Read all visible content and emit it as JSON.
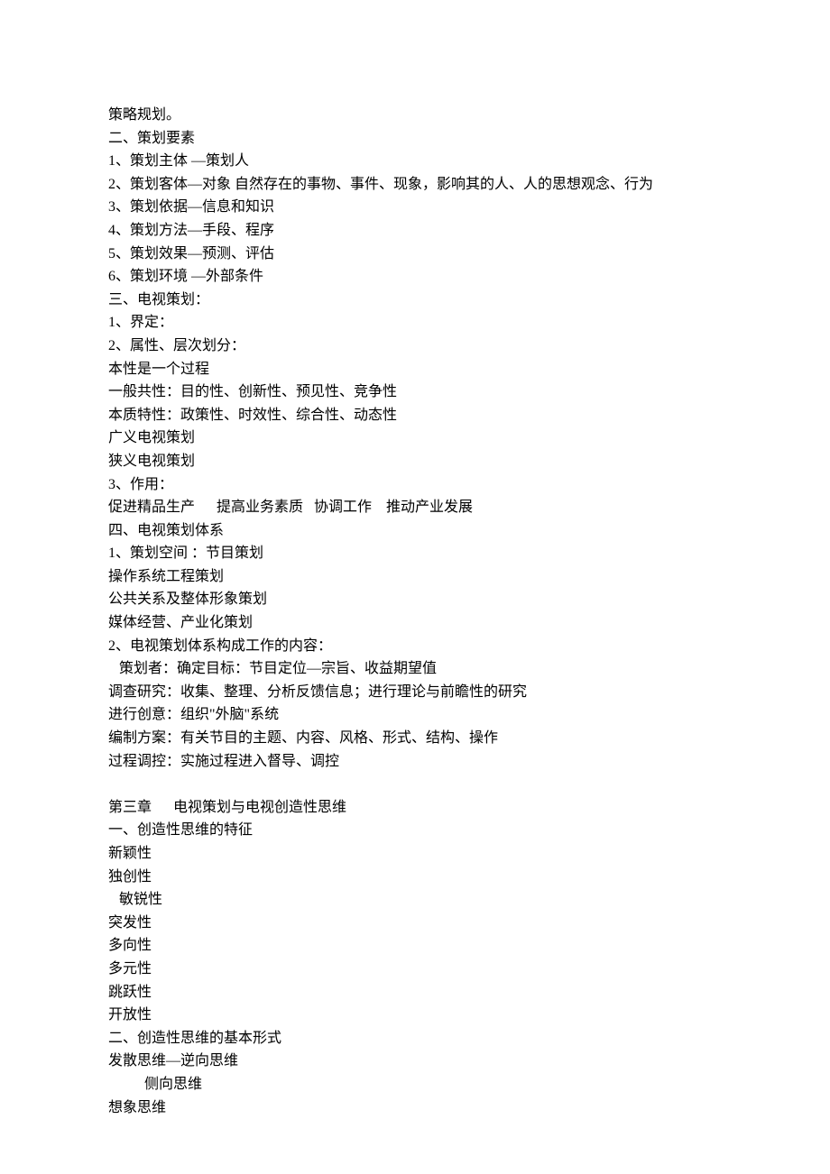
{
  "lines": [
    "策略规划。",
    "二、策划要素",
    "1、策划主体 —策划人",
    "2、策划客体—对象 自然存在的事物、事件、现象，影响其的人、人的思想观念、行为",
    "3、策划依据—信息和知识",
    "4、策划方法—手段、程序",
    "5、策划效果—预测、评估",
    "6、策划环境 —外部条件",
    "三、电视策划：",
    "1、界定：",
    "2、属性、层次划分：",
    "本性是一个过程",
    "一般共性：目的性、创新性、预见性、竞争性",
    "本质特性：政策性、时效性、综合性、动态性",
    "广义电视策划",
    "狭义电视策划",
    "3、作用：",
    "促进精品生产      提高业务素质   协调工作    推动产业发展",
    "四、电视策划体系",
    "1、策划空间 ：节目策划",
    "操作系统工程策划",
    "公共关系及整体形象策划",
    "媒体经营、产业化策划",
    "2、电视策划体系构成工作的内容：",
    "   策划者：确定目标：节目定位—宗旨、收益期望值",
    "调查研究：收集、整理、分析反馈信息；进行理论与前瞻性的研究",
    "进行创意：组织\"外脑\"系统",
    "编制方案：有关节目的主题、内容、风格、形式、结构、操作",
    "过程调控：实施过程进入督导、调控",
    "",
    "第三章      电视策划与电视创造性思维",
    "一、创造性思维的特征",
    "新颖性",
    "独创性",
    "   敏锐性",
    "突发性",
    "多向性",
    "多元性",
    "跳跃性",
    "开放性",
    "二、创造性思维的基本形式",
    "发散思维—逆向思维",
    "          侧向思维",
    "想象思维"
  ]
}
